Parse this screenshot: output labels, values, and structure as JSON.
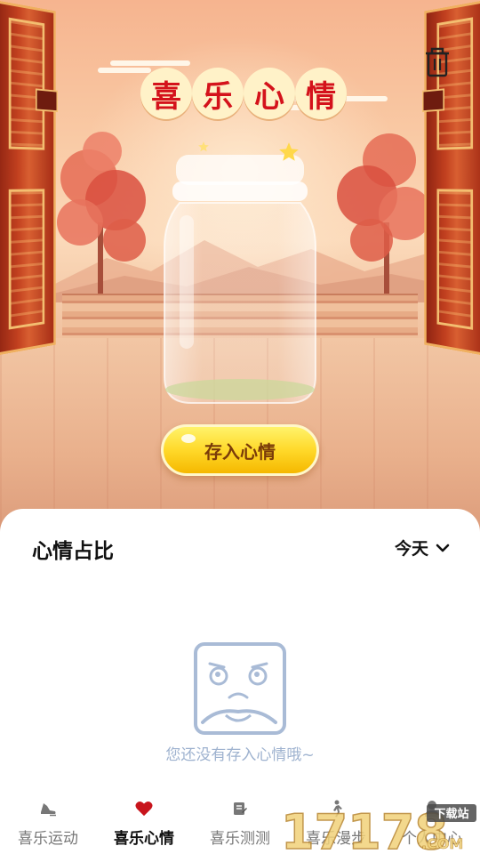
{
  "header": {
    "title_chars": [
      "喜",
      "乐",
      "心",
      "情"
    ],
    "trash_icon": "trash-icon"
  },
  "hero": {
    "save_button_label": "存入心情"
  },
  "mood_card": {
    "title": "心情占比",
    "period_label": "今天",
    "empty_text": "您还没有存入心情哦~"
  },
  "tabbar": {
    "items": [
      {
        "label": "喜乐运动",
        "icon": "sneaker-icon",
        "active": false
      },
      {
        "label": "喜乐心情",
        "icon": "heart-icon",
        "active": true
      },
      {
        "label": "喜乐测测",
        "icon": "document-edit-icon",
        "active": false
      },
      {
        "label": "喜乐漫步",
        "icon": "walk-icon",
        "active": false
      },
      {
        "label": "个人中心",
        "icon": "person-icon",
        "active": false
      }
    ]
  },
  "watermark": {
    "number": "17178",
    "suffix": ".COM",
    "badge": "下载站"
  },
  "colors": {
    "title_red": "#d4121b",
    "button_yellow": "#ffd92a",
    "empty_blue": "#9eb2cf",
    "heart_red": "#c8141c"
  }
}
